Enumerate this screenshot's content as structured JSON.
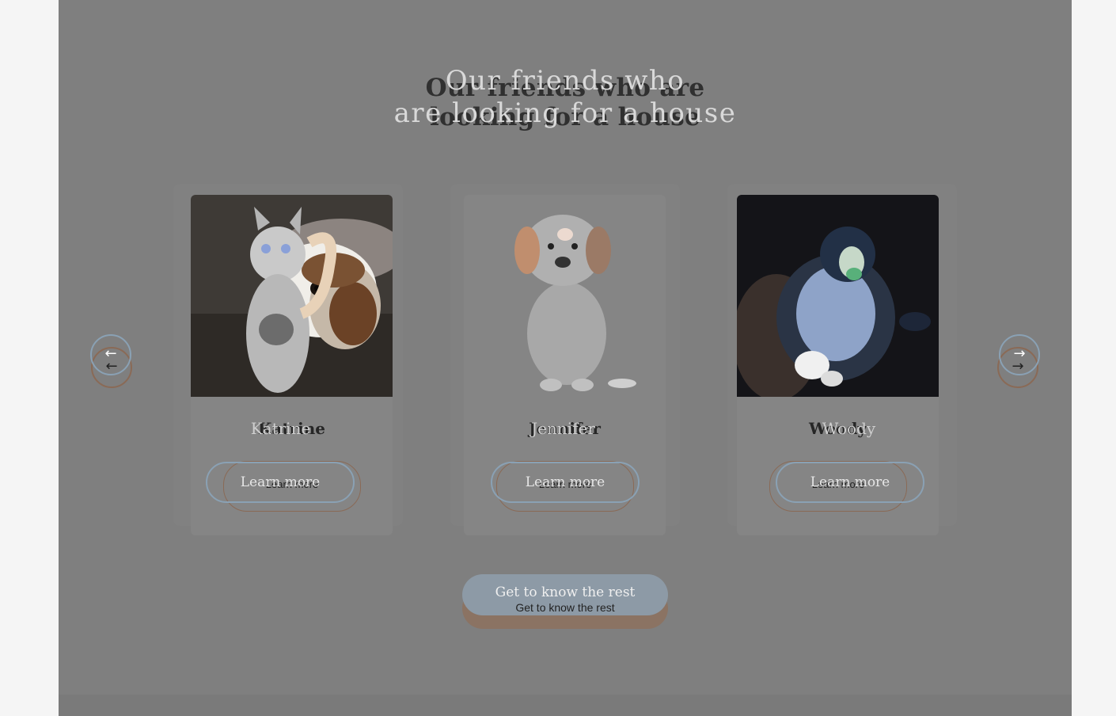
{
  "section": {
    "title_line1": "Our friends who are",
    "title_line2": "looking for a house",
    "title_overlay_line1": "Our friends who",
    "title_overlay_line2": "are looking for a house"
  },
  "pets": [
    {
      "name": "Katrine",
      "name_overlay": "Katrine",
      "button_label": "Learn more",
      "button_overlay": "Learn more",
      "photo": "cat-and-dog-photo"
    },
    {
      "name": "Jennifer",
      "name_overlay": "Jennifer",
      "button_label": "Learn more",
      "button_overlay": "Learn more",
      "photo": "puppy-photo"
    },
    {
      "name": "Woody",
      "name_overlay": "Woody",
      "button_label": "Learn more",
      "button_overlay": "Learn more",
      "photo": "dog-photo"
    }
  ],
  "nav": {
    "prev_icon": "←",
    "next_icon": "→"
  },
  "cta": {
    "label": "Get to know the rest",
    "overlay_label": "Get to know the rest"
  }
}
